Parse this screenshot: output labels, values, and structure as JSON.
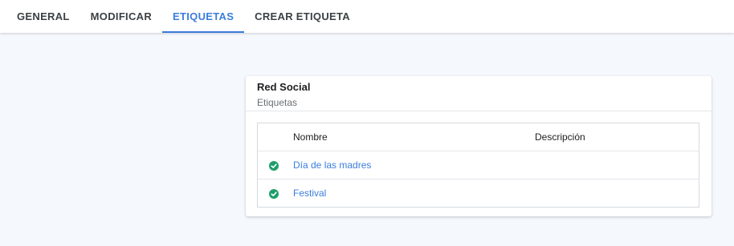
{
  "tabs": [
    {
      "label": "GENERAL",
      "active": false
    },
    {
      "label": "MODIFICAR",
      "active": false
    },
    {
      "label": "ETIQUETAS",
      "active": true
    },
    {
      "label": "CREAR ETIQUETA",
      "active": false
    }
  ],
  "card": {
    "title": "Red Social",
    "subtitle": "Etiquetas"
  },
  "table": {
    "columns": [
      "Nombre",
      "Descripción"
    ],
    "rows": [
      {
        "status_icon": "check-circle-icon",
        "name": "Día de las madres",
        "description": ""
      },
      {
        "status_icon": "check-circle-icon",
        "name": "Festival",
        "description": ""
      }
    ]
  },
  "colors": {
    "accent": "#3b7ddd",
    "status_ok": "#1e9e6a",
    "background": "#f5f9fd"
  }
}
